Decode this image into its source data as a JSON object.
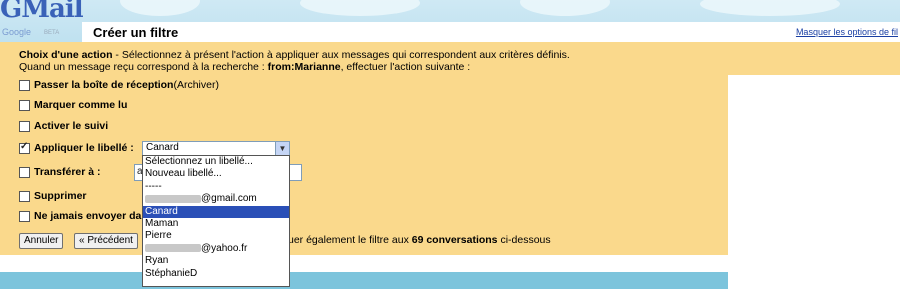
{
  "header": {
    "logo": "GMail",
    "logo_sub": "Google",
    "logo_beta": "BETA",
    "title": "Créer un filtre",
    "hide_link": "Masquer les options de fil"
  },
  "intro": {
    "heading": "Choix d'une action",
    "heading_rest": " - Sélectionnez à présent l'action à appliquer aux messages qui correspondent aux critères définis.",
    "line2_start": "Quand un message reçu correspond à la recherche : ",
    "query": "from:Marianne",
    "line2_end": ", effectuer l'action suivante :"
  },
  "actions": {
    "archive": {
      "label": "Passer la boîte de réception",
      "extra": " (Archiver)",
      "checked": false
    },
    "mark_read": {
      "label": "Marquer comme lu",
      "checked": false
    },
    "star": {
      "label": "Activer le suivi",
      "checked": false
    },
    "apply_label": {
      "label": "Appliquer le libellé :",
      "checked": true,
      "selected": "Canard"
    },
    "forward": {
      "label": "Transférer à :",
      "placeholder": "adresse",
      "checked": false
    },
    "delete": {
      "label": "Supprimer",
      "checked": false
    },
    "never_spam": {
      "label": "Ne jamais envoyer da",
      "checked": false
    }
  },
  "dropdown": {
    "items": [
      "Sélectionnez un libellé...",
      "Nouveau libellé...",
      "-----",
      "@gmail.com",
      "Canard",
      "Maman",
      "Pierre",
      "@yahoo.fr",
      "Ryan",
      "StéphanieD"
    ],
    "selected_index": 4
  },
  "buttons": {
    "cancel": "Annuler",
    "previous": "« Précédent"
  },
  "apply_also": {
    "start": "uer également le filtre aux ",
    "count": "69 conversations",
    "end": " ci-dessous"
  },
  "colors": {
    "panel": "#fad98c",
    "selection": "#2a4fb7",
    "link": "#1a3fa3"
  }
}
